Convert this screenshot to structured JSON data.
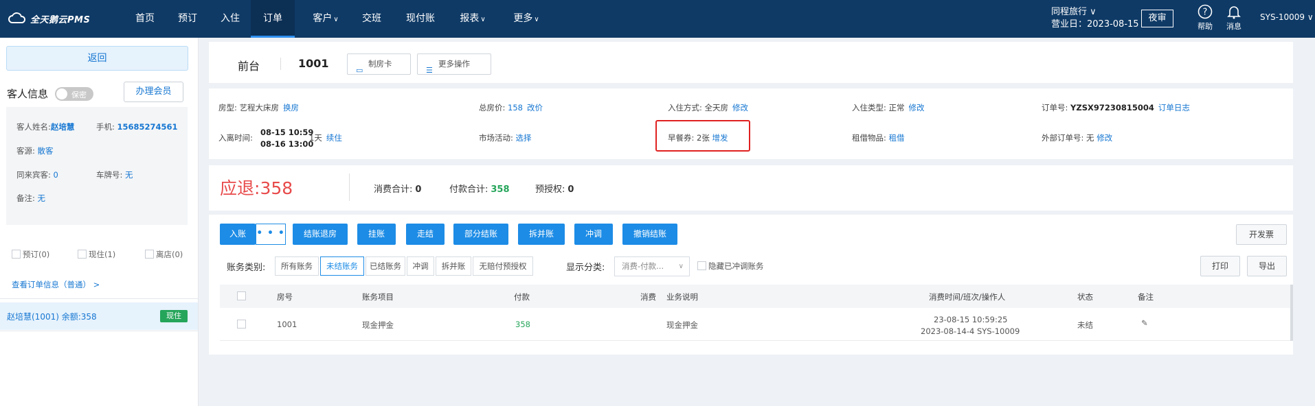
{
  "nav": {
    "logo": "全天鹅云PMS",
    "items": [
      {
        "label": "首页"
      },
      {
        "label": "预订"
      },
      {
        "label": "入住"
      },
      {
        "label": "订单"
      },
      {
        "label": "客户",
        "chevron": "∨"
      },
      {
        "label": "交班"
      },
      {
        "label": "现付账"
      },
      {
        "label": "报表",
        "chevron": "∨"
      },
      {
        "label": "更多",
        "chevron": "∨"
      }
    ],
    "hotel_name": "同程旅行 ∨",
    "business_date": "营业日：2023-08-15",
    "night_audit": "夜审",
    "help": "帮助",
    "messages": "消息",
    "user": "SYS-10009 ∨"
  },
  "left": {
    "back": "返回",
    "guest_info_title": "客人信息",
    "privacy_toggle": "保密",
    "member_button": "办理会员",
    "guest_name_label": "客人姓名:",
    "guest_name": "赵培慧",
    "phone_label": "手机:",
    "phone": "15685274561",
    "source_label": "客源:",
    "source": "散客",
    "companions_label": "同来宾客:",
    "companions": "0",
    "plate_label": "车牌号:",
    "plate": "无",
    "remark_label": "备注:",
    "remark": "无",
    "filters": [
      "预订(0)",
      "现住(1)",
      "离店(0)"
    ],
    "order_info_link": "查看订单信息（普通） >",
    "room_entry": "赵培慧(1001)  余额:358",
    "room_status": "现住"
  },
  "header": {
    "tab": "前台",
    "room": "1001",
    "make_card": "制房卡",
    "more_ops": "更多操作"
  },
  "info": {
    "room_type_label": "房型:",
    "room_type": "艺程大床房",
    "change_room": "换房",
    "total_label": "总房价:",
    "total": "158",
    "change_price": "改价",
    "checkin_mode_label": "入住方式:",
    "checkin_mode": "全天房",
    "edit1": "修改",
    "checkin_type_label": "入住类型:",
    "checkin_type": "正常",
    "edit2": "修改",
    "order_no_label": "订单号:",
    "order_no": "YZSX97230815004",
    "order_log": "订单日志",
    "stay_label": "入离时间:",
    "stay_in": "08-15 10:59",
    "stay_out": "08-16 13:00",
    "nights": "1天",
    "extend": "续住",
    "market_label": "市场活动:",
    "market": "选择",
    "breakfast_label": "早餐券:",
    "breakfast": "2张",
    "breakfast_add": "增发",
    "rental_label": "租借物品:",
    "rental": "租借",
    "ext_order_label": "外部订单号:",
    "ext_order": "无",
    "edit3": "修改"
  },
  "summary": {
    "refund_label": "应退:",
    "refund": "358",
    "consume_label": "消费合计:",
    "consume": "0",
    "paid_label": "付款合计:",
    "paid": "358",
    "preauth_label": "预授权:",
    "preauth": "0"
  },
  "bill": {
    "actions": [
      "入账",
      "结账退房",
      "挂账",
      "走结",
      "部分结账",
      "拆并账",
      "冲调",
      "撤销结账"
    ],
    "more": "• • •",
    "invoice": "开发票",
    "category_label": "账务类别:",
    "categories": [
      "所有账务",
      "未结账务",
      "已结账务",
      "冲调",
      "拆并账",
      "无赔付预授权"
    ],
    "display_label": "显示分类:",
    "display_value": "消费-付款...",
    "hide_adjust": "隐藏已冲调账务",
    "print": "打印",
    "export": "导出",
    "columns": [
      "房号",
      "账务项目",
      "付款",
      "消费",
      "业务说明",
      "消费时间/班次/操作人",
      "状态",
      "备注"
    ],
    "rows": [
      {
        "room": "1001",
        "item": "现金押金",
        "pay": "358",
        "consume": "",
        "desc": "现金押金",
        "time1": "23-08-15 10:59:25",
        "time2": "2023-08-14-4 SYS-10009",
        "status": "未结"
      }
    ]
  }
}
